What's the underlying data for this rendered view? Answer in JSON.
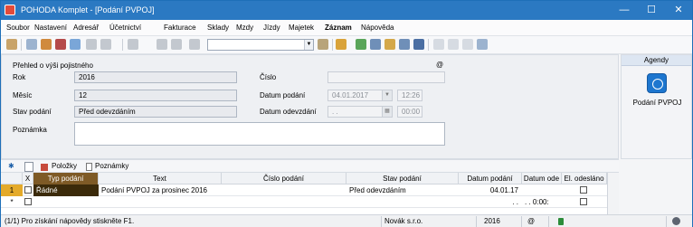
{
  "window": {
    "title": "POHODA Komplet - [Podání PVPOJ]",
    "controls": [
      "—",
      "☐",
      "✕"
    ]
  },
  "menu": [
    "Soubor",
    "Nastavení",
    "Adresář",
    "Účetnictví",
    "Fakturace",
    "Sklady",
    "Mzdy",
    "Jízdy",
    "Majetek",
    "Záznam",
    "Nápověda"
  ],
  "form": {
    "section_title": "Přehled o výši pojistného",
    "at_symbol": "@",
    "rok": {
      "label": "Rok",
      "value": "2016"
    },
    "mesic": {
      "label": "Měsíc",
      "value": "12"
    },
    "stav": {
      "label": "Stav podání",
      "value": "Před odevzdáním"
    },
    "poznamka": {
      "label": "Poznámka",
      "value": ""
    },
    "cislo": {
      "label": "Číslo",
      "value": ""
    },
    "datum_podani": {
      "label": "Datum podání",
      "value": "04.01.2017",
      "time": "12:26"
    },
    "datum_odevzdani": {
      "label": "Datum odevzdání",
      "value": ". .",
      "time": "00:00"
    }
  },
  "agenda": {
    "header": "Agendy",
    "item_label": "Podání PVPOJ"
  },
  "tabs": {
    "star": "✱",
    "polozky": "Položky",
    "poznamky": "Poznámky"
  },
  "grid": {
    "headers": {
      "x": "X",
      "typ": "Typ podání",
      "text": "Text",
      "cislo": "Číslo podání",
      "stav": "Stav podání",
      "datum": "Datum podání",
      "datum_od": "Datum ode",
      "el": "El. odesláno"
    },
    "rows": [
      {
        "num": "1",
        "typ": "Řádné",
        "text": "Podání PVPOJ za prosinec 2016",
        "cislo": "",
        "stav": "Před odevzdáním",
        "datum": "04.01.17",
        "datum_od": ""
      },
      {
        "num": "*",
        "typ": "",
        "text": "",
        "cislo": "",
        "stav": "",
        "datum": ". .",
        "datum_od": ". . 0:00:"
      }
    ]
  },
  "status": {
    "help": "(1/1) Pro získání nápovědy stiskněte F1.",
    "company": "Novák s.r.o.",
    "year": "2016",
    "at": "@"
  }
}
